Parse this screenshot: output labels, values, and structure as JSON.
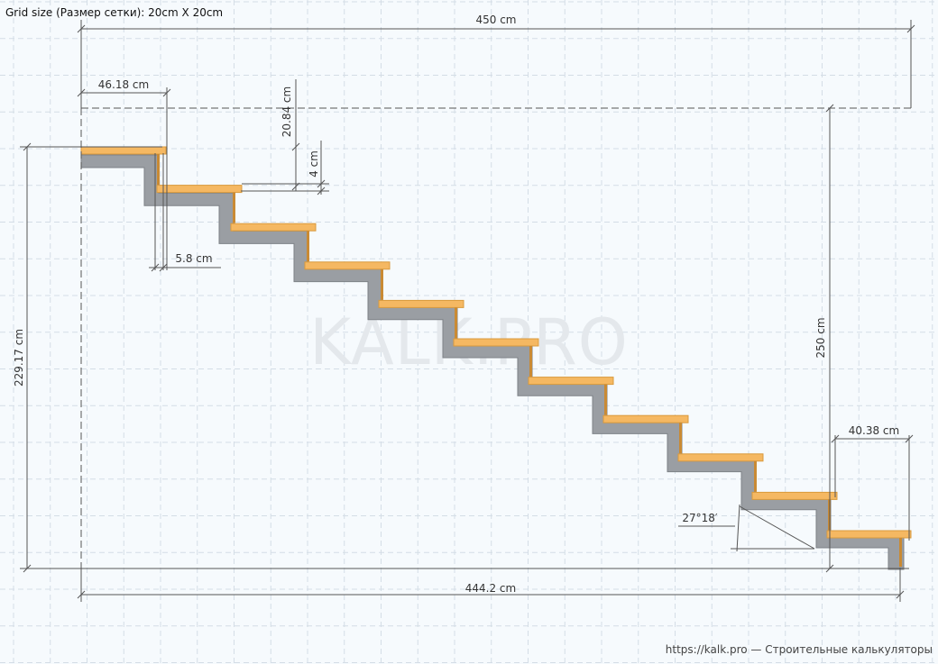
{
  "header": {
    "grid_label": "Grid size (Размер сетки): 20cm X 20cm"
  },
  "watermark": "KALK.PRO",
  "footer": {
    "credit": "https://kalk.pro — Строительные калькуляторы"
  },
  "dimensions": {
    "total_width": "450 cm",
    "base_length": "444.2 cm",
    "stair_height": "229.17 cm",
    "total_height": "250 cm",
    "tread_depth": "46.18 cm",
    "riser_height": "20.84 cm",
    "tread_thickness": "4 cm",
    "overhang": "5.8 cm",
    "last_tread": "40.38 cm",
    "angle": "27°18′"
  },
  "colors": {
    "tread": "#f5b862",
    "tread_edge": "#d99a3d",
    "stringer": "#9a9ea3",
    "stringer_edge": "#7e8287",
    "riser_board": "#c98a34",
    "grid": "#d4dde6"
  }
}
